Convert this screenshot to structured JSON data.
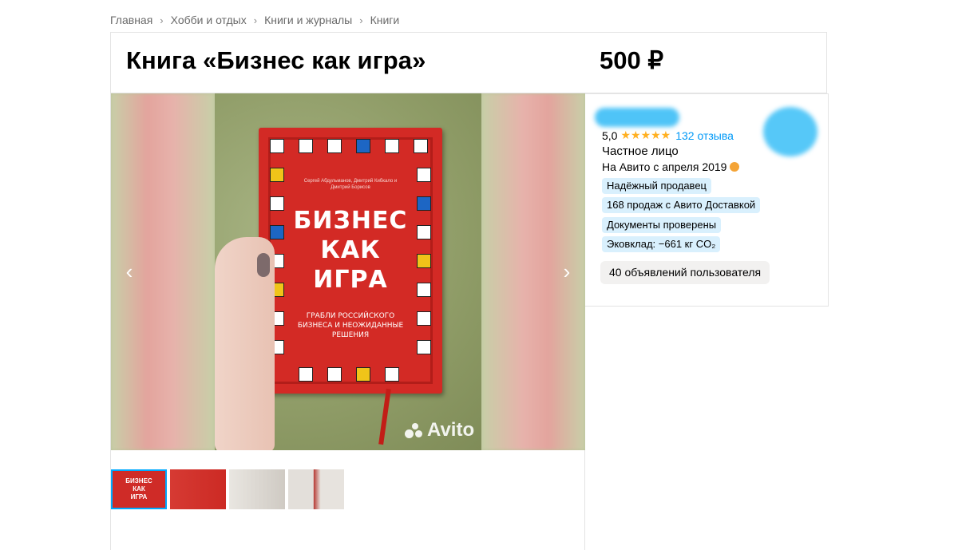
{
  "breadcrumb": [
    "Главная",
    "Хобби и отдых",
    "Книги и журналы",
    "Книги"
  ],
  "listing": {
    "title": "Книга «Бизнес как игра»",
    "price": "500 ₽"
  },
  "gallery": {
    "book_authors": "Сергей Абдульманов, Дмитрий Кибкало и Дмитрий Борисов",
    "book_title_lines": [
      "БИЗНЕС",
      "КАК",
      "ИГРА"
    ],
    "book_subtitle": "ГРАБЛИ РОССИЙСКОГО БИЗНЕСА И НЕОЖИДАННЫЕ РЕШЕНИЯ",
    "watermark": "Avito",
    "thumbnails_count": 4,
    "active_thumbnail": 1
  },
  "seller": {
    "rating": "5,0",
    "stars": "★★★★★",
    "reviews": "132 отзыва",
    "type": "Частное лицо",
    "since": "На Авито с апреля 2019",
    "badges": [
      "Надёжный продавец",
      "168 продаж с Авито Доставкой",
      "Документы проверены",
      "Эковклад: −661 кг CO₂"
    ],
    "ads_button": "40 объявлений пользователя"
  },
  "colors": {
    "accent_blue": "#0099f7",
    "badge_bg": "#d9f0fd",
    "star": "#ffb021"
  }
}
